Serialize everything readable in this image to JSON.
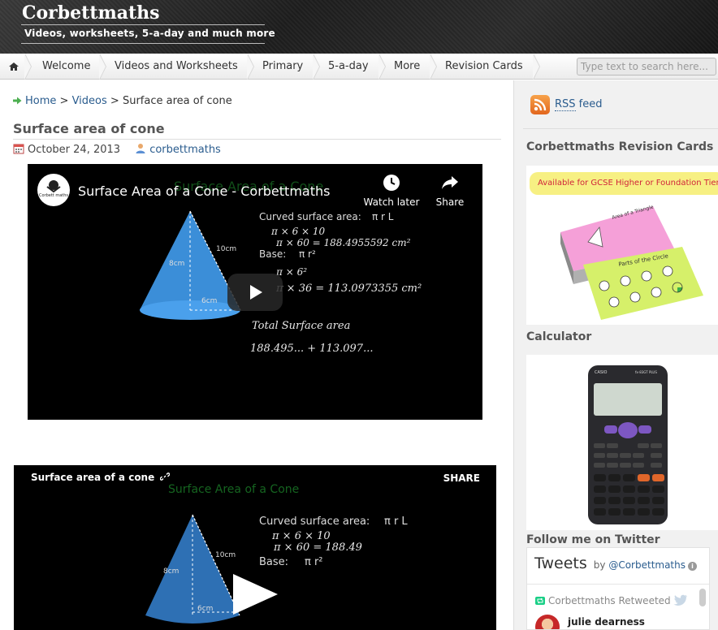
{
  "header": {
    "site_title": "Corbettmaths",
    "tagline": "Videos, worksheets, 5-a-day and much more"
  },
  "nav": {
    "items": [
      "Welcome",
      "Videos and Worksheets",
      "Primary",
      "5-a-day",
      "More",
      "Revision Cards"
    ],
    "search_placeholder": "Type text to search here..."
  },
  "breadcrumb": {
    "home": "Home",
    "sep1": ">",
    "videos": "Videos",
    "sep2": ">",
    "current": "Surface area of cone"
  },
  "post": {
    "title": "Surface area of cone",
    "date": "October 24, 2013",
    "author": "corbettmaths"
  },
  "video1": {
    "title": "Surface Area of a Cone - Corbettmaths",
    "channel_logo_text": "Corbett maths",
    "watch_later": "Watch later",
    "share": "Share",
    "board_title": "Surface Area of a Cone",
    "curved_label": "Curved surface area:",
    "curved_formula": "π r L",
    "line1": "π × 6 × 10",
    "line2": "π × 60 = 188.4955592 cm²",
    "base_label": "Base:",
    "base_formula": "π r²",
    "line3": "π × 6²",
    "line4": "π × 36 = 113.0973355 cm²",
    "total_label": "Total Surface area",
    "total_line": "188.495... + 113.097...",
    "dim_slant": "10cm",
    "dim_height": "8cm",
    "dim_radius": "6cm"
  },
  "video2": {
    "title": "Surface area of a cone",
    "share": "SHARE",
    "board_title": "Surface Area of a Cone",
    "curved_label": "Curved surface area:",
    "curved_formula": "π r L",
    "line1": "π × 6 × 10",
    "line2": "π × 60 = 188.49",
    "base_label": "Base:",
    "base_formula": "π r²",
    "dim_slant": "10cm",
    "dim_height": "8cm",
    "dim_radius": "6cm"
  },
  "sidebar": {
    "rss_abbr": "RSS",
    "rss_text": " feed",
    "revision_heading": "Corbettmaths Revision Cards",
    "revision_banner": "Available for GCSE Higher or Foundation Tier",
    "card_pink_label": "Area of a Triangle",
    "card_green_label": "Parts of the Circle",
    "calculator_heading": "Calculator",
    "calc_brand": "CASIO",
    "calc_model": "fx-83GT PLUS",
    "twitter_heading": "Follow me on Twitter",
    "tweets_title": "Tweets",
    "tweets_by": "by",
    "tweets_handle": "@Corbettmaths",
    "retweeted_text": "Corbettmaths Retweeted",
    "tweet_user": "julie dearness"
  },
  "colors": {
    "link": "#2a5c8e",
    "header_bg": "#1e1e1e",
    "sidebar_bg": "#f1f1f1",
    "cone_blue": "#3b8ed8",
    "banner_yellow": "#f7f083",
    "banner_text": "#d0233a"
  }
}
